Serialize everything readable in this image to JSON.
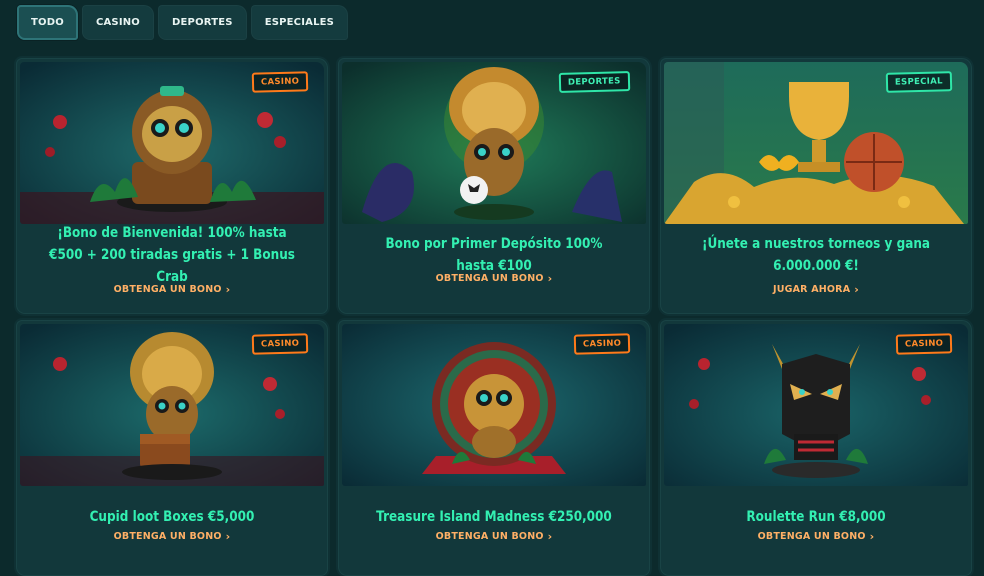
{
  "tabs": [
    {
      "label": "TODO",
      "active": true
    },
    {
      "label": "CASINO",
      "active": false
    },
    {
      "label": "DEPORTES",
      "active": false
    },
    {
      "label": "ESPECIALES",
      "active": false
    }
  ],
  "cards": [
    {
      "badge": "CASINO",
      "title": "¡Bono de Bienvenida! 100% hasta €500 + 200 tiradas gratis + 1 Bonus Crab",
      "cta": "OBTENGA UN BONO"
    },
    {
      "badge": "DEPORTES",
      "title": "Bono por Primer Depósito 100% hasta €100",
      "cta": "OBTENGA UN BONO"
    },
    {
      "badge": "ESPECIAL",
      "title": "¡Únete a nuestros torneos y gana 6.000.000 €!",
      "cta": "JUGAR AHORA"
    },
    {
      "badge": "CASINO",
      "title": "Cupid loot Boxes €5,000",
      "cta": "OBTENGA UN BONO"
    },
    {
      "badge": "CASINO",
      "title": "Treasure Island Madness €250,000",
      "cta": "OBTENGA UN BONO"
    },
    {
      "badge": "CASINO",
      "title": "Roulette Run €8,000",
      "cta": "OBTENGA UN BONO"
    }
  ],
  "icons": {
    "cta_chevron": "chevron-right-icon"
  },
  "colors": {
    "background": "#0c2a2c",
    "card": "#12383b",
    "title": "#33f0b2",
    "cta": "#ffb066",
    "badge_casino": "#ff7a1a",
    "badge_green": "#2fe6a8"
  }
}
